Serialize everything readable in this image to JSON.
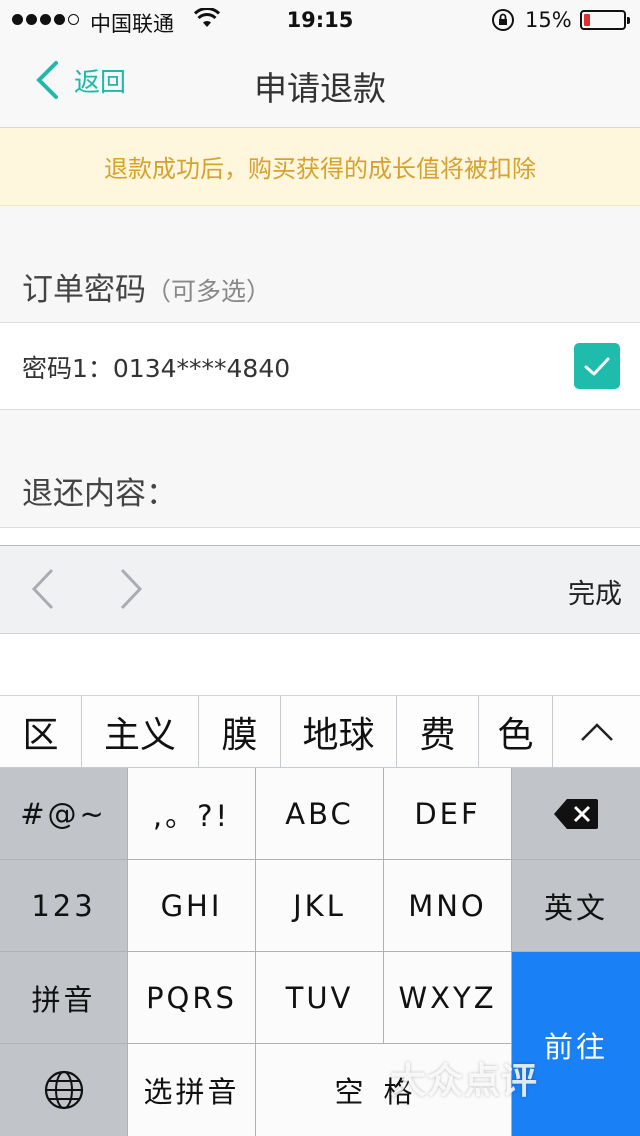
{
  "status_bar": {
    "carrier": "中国联通",
    "time": "19:15",
    "battery_percent": "15%",
    "battery_level": 0.15,
    "battery_color": "#e03030",
    "signal_bars_filled": 4,
    "icons": [
      "signal-dots-icon",
      "wifi-icon",
      "orientation-lock-icon",
      "battery-icon"
    ]
  },
  "nav": {
    "back_label": "返回",
    "title": "申请退款",
    "accent_color": "#1fb9ac"
  },
  "notice": {
    "text": "退款成功后，购买获得的成长值将被扣除",
    "text_color": "#d8a12e",
    "bg_color": "#fef6dd"
  },
  "order_code": {
    "label": "订单密码",
    "hint": "（可多选）",
    "items": [
      {
        "label": "密码1：0134****4840",
        "checked": true
      }
    ]
  },
  "refund_content": {
    "label": "退还内容："
  },
  "accessory": {
    "done_label": "完成",
    "icons": [
      "prev-chevron-icon",
      "next-chevron-icon"
    ]
  },
  "candidates": [
    "区",
    "主义",
    "膜",
    "地球",
    "费",
    "色"
  ],
  "keyboard": {
    "row1": [
      "#@~",
      ",。?!",
      "ABC",
      "DEF"
    ],
    "row2": [
      "123",
      "GHI",
      "JKL",
      "MNO",
      "英文"
    ],
    "row3": [
      "拼音",
      "PQRS",
      "TUV",
      "WXYZ"
    ],
    "row4": [
      "选拼音",
      "空格"
    ],
    "go_label": "前往",
    "go_color": "#1a80f5"
  },
  "watermark": "大众点评"
}
